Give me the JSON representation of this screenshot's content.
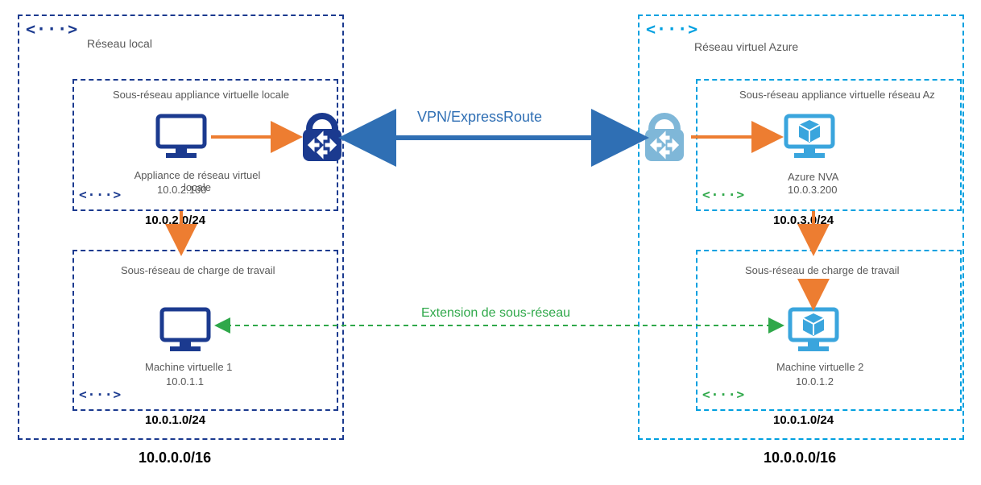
{
  "onprem": {
    "title": "Réseau local",
    "address_space": "10.0.0.0/16",
    "subnet_nva": {
      "title": "Sous-réseau appliance virtuelle locale",
      "cidr": "10.0.2.0/24",
      "device_label": "Appliance de réseau virtuel locale",
      "device_ip": "10.0.2.100"
    },
    "subnet_workload": {
      "title": "Sous-réseau de charge de travail",
      "cidr": "10.0.1.0/24",
      "vm_label": "Machine virtuelle 1",
      "vm_ip": "10.0.1.1"
    }
  },
  "azure": {
    "title": "Réseau virtuel Azure",
    "address_space": "10.0.0.0/16",
    "subnet_nva": {
      "title": "Sous-réseau appliance virtuelle réseau Az",
      "cidr": "10.0.3.0/24",
      "device_label": "Azure NVA",
      "device_ip": "10.0.3.200"
    },
    "subnet_workload": {
      "title": "Sous-réseau de charge de travail",
      "cidr": "10.0.1.0/24",
      "vm_label": "Machine virtuelle 2",
      "vm_ip": "10.0.1.2"
    }
  },
  "connection_label": "VPN/ExpressRoute",
  "extension_label": "Extension de sous-réseau",
  "colors": {
    "onprem_blue": "#1b3a8f",
    "azure_blue": "#3aa5dd",
    "orange": "#ed7d31",
    "green": "#2fa84a",
    "grey": "#7f7f7f"
  }
}
